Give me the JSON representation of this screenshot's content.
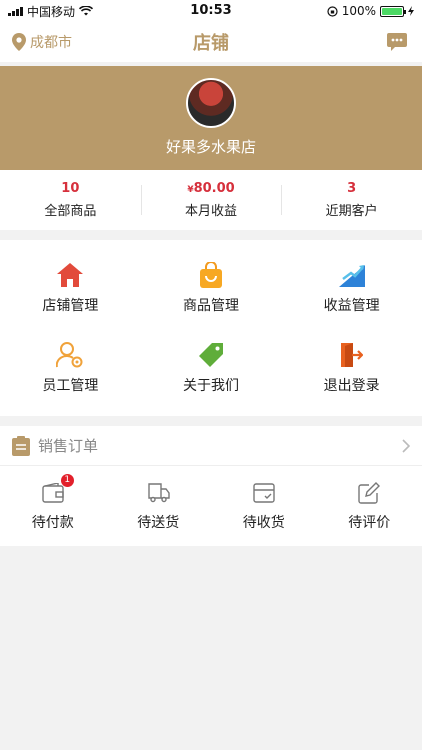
{
  "status_bar": {
    "carrier": "中国移动",
    "time": "10:53",
    "battery": "100%",
    "battery_level": 1.0
  },
  "nav": {
    "location": "成都市",
    "title": "店铺"
  },
  "shop": {
    "name": "好果多水果店"
  },
  "stats": [
    {
      "value": "10",
      "currency": "",
      "label": "全部商品"
    },
    {
      "value": "80.00",
      "currency": "¥",
      "label": "本月收益"
    },
    {
      "value": "3",
      "currency": "",
      "label": "近期客户"
    }
  ],
  "menu": [
    {
      "label": "店铺管理",
      "icon": "home-icon"
    },
    {
      "label": "商品管理",
      "icon": "shopping-bag-icon"
    },
    {
      "label": "收益管理",
      "icon": "chart-icon"
    },
    {
      "label": "员工管理",
      "icon": "staff-settings-icon"
    },
    {
      "label": "关于我们",
      "icon": "tag-icon"
    },
    {
      "label": "退出登录",
      "icon": "logout-icon"
    }
  ],
  "orders": {
    "title": "销售订单",
    "items": [
      {
        "label": "待付款",
        "icon": "wallet-icon",
        "badge": "1"
      },
      {
        "label": "待送货",
        "icon": "truck-icon",
        "badge": ""
      },
      {
        "label": "待收货",
        "icon": "package-icon",
        "badge": ""
      },
      {
        "label": "待评价",
        "icon": "edit-icon",
        "badge": ""
      }
    ]
  },
  "colors": {
    "accent": "#b89a6a",
    "price": "#d6303c",
    "badge": "#e2202b"
  }
}
